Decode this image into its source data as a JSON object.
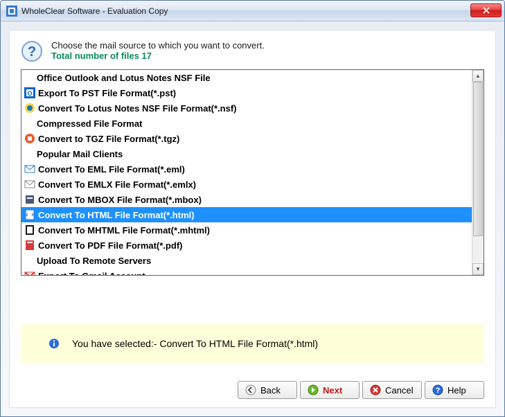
{
  "window": {
    "title": "WholeClear Software - Evaluation Copy"
  },
  "header": {
    "instruction": "Choose the mail source to which you want to convert.",
    "sub_prefix": "Total number of files ",
    "file_count": "17"
  },
  "list": {
    "rows": [
      {
        "type": "header",
        "label": "Office Outlook and Lotus Notes NSF File"
      },
      {
        "type": "item",
        "icon": "outlook",
        "label": "Export To PST File Format(*.pst)"
      },
      {
        "type": "item",
        "icon": "lotus",
        "label": "Convert To Lotus Notes NSF File Format(*.nsf)"
      },
      {
        "type": "header",
        "label": "Compressed File Format"
      },
      {
        "type": "item",
        "icon": "tgz",
        "label": "Convert to TGZ File Format(*.tgz)"
      },
      {
        "type": "header",
        "label": "Popular Mail Clients"
      },
      {
        "type": "item",
        "icon": "eml",
        "label": "Convert To EML File Format(*.eml)"
      },
      {
        "type": "item",
        "icon": "emlx",
        "label": "Convert To EMLX File Format(*.emlx)"
      },
      {
        "type": "item",
        "icon": "mbox",
        "label": "Convert To MBOX File Format(*.mbox)"
      },
      {
        "type": "item",
        "icon": "html",
        "label": "Convert To HTML File Format(*.html)",
        "selected": true
      },
      {
        "type": "item",
        "icon": "mhtml",
        "label": "Convert To MHTML File Format(*.mhtml)"
      },
      {
        "type": "item",
        "icon": "pdf",
        "label": "Convert To PDF File Format(*.pdf)"
      },
      {
        "type": "header",
        "label": "Upload To Remote Servers"
      },
      {
        "type": "item",
        "icon": "gmail",
        "label": "Export To Gmail Account"
      }
    ]
  },
  "info": {
    "prefix": "You have selected:- ",
    "selection": "Convert To HTML File Format(*.html)"
  },
  "buttons": {
    "back": "Back",
    "next": "Next",
    "cancel": "Cancel",
    "help": "Help"
  }
}
